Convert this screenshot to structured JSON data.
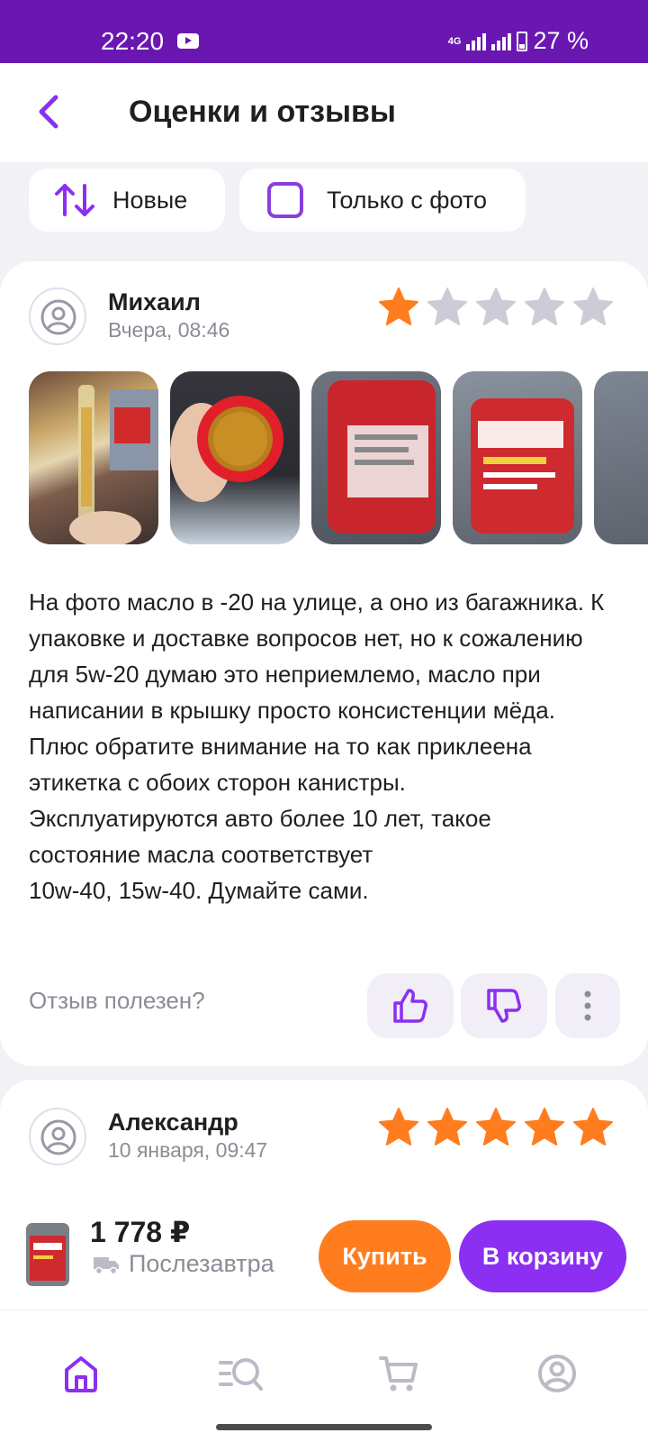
{
  "status_bar": {
    "time": "22:20",
    "network": "4G",
    "battery": "27 %"
  },
  "header": {
    "title": "Оценки и отзывы"
  },
  "filters": {
    "sort_label": "Новые",
    "photo_only_label": "Только с фото"
  },
  "reviews": [
    {
      "author": "Михаил",
      "date": "Вчера, 08:46",
      "rating": 1,
      "max_rating": 5,
      "text": "На фото масло в -20 на улице, а оно из багажника. К упаковке и доставке вопросов нет, но к сожалению для 5w-20 думаю это неприемлемо, масло при написании в крышку просто консистенции мёда.\nПлюс обратите внимание на то как приклеена этикетка с обоих сторон канистры.\nЭксплуатируются авто более 10 лет, такое состояние масла соответствует\n10w-40, 15w-40. Думайте сами.",
      "helpful_question": "Отзыв полезен?"
    },
    {
      "author": "Александр",
      "date": "10 января, 09:47",
      "rating": 5,
      "max_rating": 5
    }
  ],
  "product_bar": {
    "price": "1 778 ₽",
    "delivery": "Послезавтра",
    "buy_label": "Купить",
    "cart_label": "В корзину"
  },
  "colors": {
    "accent": "#8b2ff3",
    "header": "#6a17b2",
    "star_on": "#ff7d1f",
    "star_off": "#cdcbd6"
  }
}
